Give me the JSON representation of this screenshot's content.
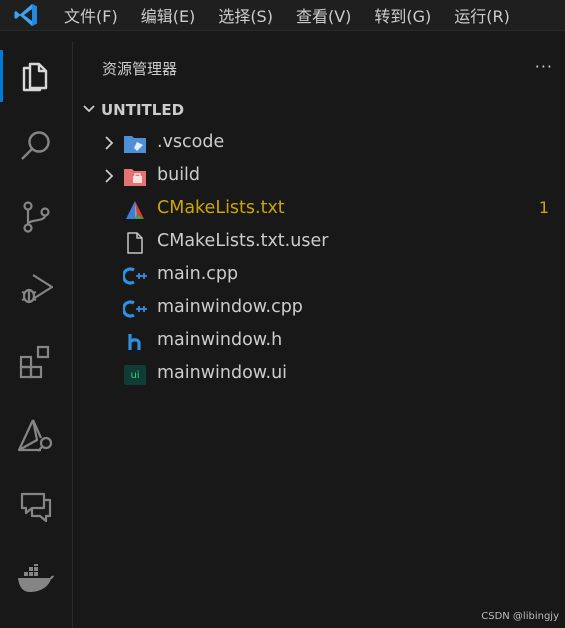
{
  "menu": [
    "文件(F)",
    "编辑(E)",
    "选择(S)",
    "查看(V)",
    "转到(G)",
    "运行(R)"
  ],
  "colors": {
    "accent": "#0078d4",
    "warning": "#cca700",
    "background": "#181818"
  },
  "activity_bar": [
    {
      "icon": "files-icon",
      "active": true
    },
    {
      "icon": "search-icon"
    },
    {
      "icon": "source-control-icon"
    },
    {
      "icon": "run-debug-icon"
    },
    {
      "icon": "extensions-icon"
    },
    {
      "icon": "cmake-icon"
    },
    {
      "icon": "remote-explorer-icon"
    },
    {
      "icon": "docker-icon"
    }
  ],
  "sidebar": {
    "title": "资源管理器",
    "more": "···",
    "section": "UNTITLED",
    "files": [
      {
        "name": ".vscode",
        "type": "folder",
        "icon": "vscode-folder-icon"
      },
      {
        "name": "build",
        "type": "folder",
        "icon": "build-folder-icon"
      },
      {
        "name": "CMakeLists.txt",
        "type": "file",
        "icon": "cmake-file-icon",
        "badge": "1"
      },
      {
        "name": "CMakeLists.txt.user",
        "type": "file",
        "icon": "file-icon"
      },
      {
        "name": "main.cpp",
        "type": "file",
        "icon": "cpp-file-icon"
      },
      {
        "name": "mainwindow.cpp",
        "type": "file",
        "icon": "cpp-file-icon"
      },
      {
        "name": "mainwindow.h",
        "type": "file",
        "icon": "header-file-icon"
      },
      {
        "name": "mainwindow.ui",
        "type": "file",
        "icon": "ui-file-icon",
        "icon_text": "ui"
      }
    ]
  },
  "watermark": "CSDN @libingjy"
}
